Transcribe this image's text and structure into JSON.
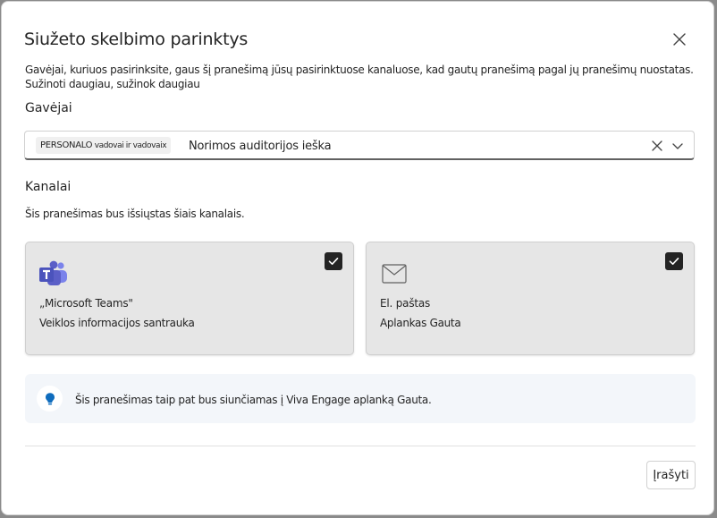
{
  "dialog": {
    "title": "Siužeto skelbimo parinktys",
    "close_icon": "close-icon",
    "description": "Gavėjai, kuriuos pasirinksite, gaus šį pranešimą jūsų pasirinktuose kanaluose, kad gautų pranešimą pagal jų pranešimų nuostatas.",
    "learn_more": "Sužinoti daugiau, sužinok daugiau"
  },
  "recipients": {
    "label": "Gavėjai",
    "chip_main": "PERSONALO",
    "chip_extra": " vadovai ir vadovai",
    "chip_remove": "x",
    "placeholder": "Norimos auditorijos ieška",
    "clear_icon": "clear-icon",
    "dropdown_icon": "chevron-down-icon"
  },
  "channels": {
    "label": "Kanalai",
    "description": "Šis pranešimas bus išsiųstas šiais kanalais.",
    "items": [
      {
        "title": "„Microsoft Teams\"",
        "subtitle": "Veiklos informacijos santrauka",
        "icon": "teams-icon",
        "checked": true
      },
      {
        "title": "El. paštas",
        "subtitle": "Aplankas Gauta",
        "icon": "mail-icon",
        "checked": true
      }
    ]
  },
  "info": {
    "icon": "lightbulb-icon",
    "text": "Šis pranešimas taip pat bus siunčiamas į Viva Engage aplanką Gauta."
  },
  "footer": {
    "save_label": "Įrašyti"
  },
  "colors": {
    "card_bg": "#e6e6e6",
    "checkbox": "#242424",
    "teams_purple": "#5b5fc7",
    "bulb_blue": "#0f6cbd",
    "info_bg": "#f3f6fa"
  }
}
